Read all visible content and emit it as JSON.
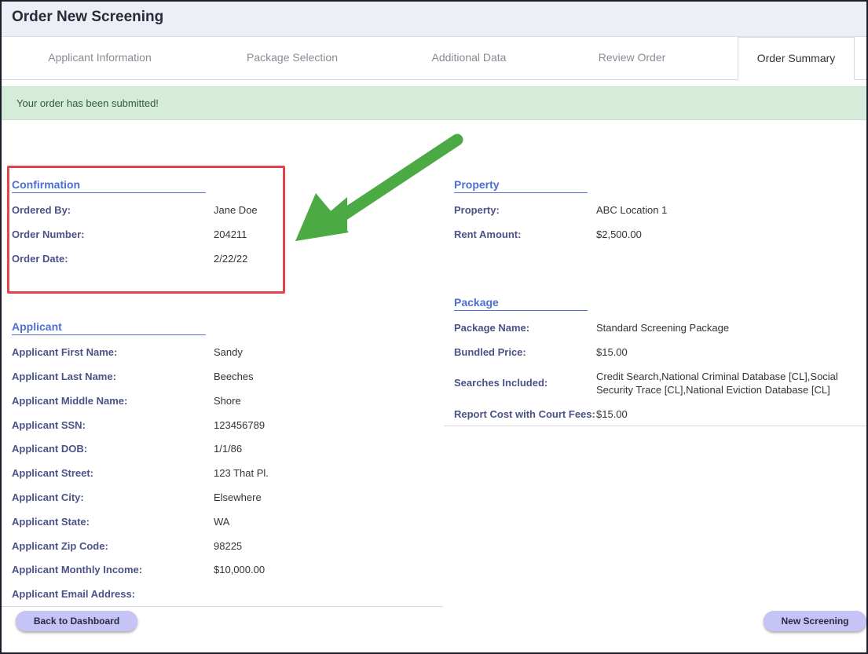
{
  "header": {
    "title": "Order New Screening"
  },
  "tabs": [
    {
      "label": "Applicant Information"
    },
    {
      "label": "Package Selection"
    },
    {
      "label": "Additional Data"
    },
    {
      "label": "Review Order"
    },
    {
      "label": "Order Summary",
      "active": true
    }
  ],
  "alert": {
    "message": "Your order has been submitted!"
  },
  "confirmation": {
    "title": "Confirmation",
    "rows": [
      {
        "label": "Ordered By:",
        "value": "Jane Doe"
      },
      {
        "label": "Order Number:",
        "value": "204211"
      },
      {
        "label": "Order Date:",
        "value": "2/22/22"
      }
    ]
  },
  "property": {
    "title": "Property",
    "rows": [
      {
        "label": "Property:",
        "value": "ABC Location 1"
      },
      {
        "label": "Rent Amount:",
        "value": "$2,500.00"
      }
    ]
  },
  "package": {
    "title": "Package",
    "rows": [
      {
        "label": "Package Name:",
        "value": "Standard Screening Package"
      },
      {
        "label": "Bundled Price:",
        "value": "$15.00"
      },
      {
        "label": "Searches Included:",
        "value": "Credit Search,National Criminal Database [CL],Social Security Trace [CL],National Eviction Database [CL]"
      },
      {
        "label": "Report Cost with Court Fees:",
        "value": "$15.00"
      }
    ]
  },
  "applicant": {
    "title": "Applicant",
    "rows": [
      {
        "label": "Applicant First Name:",
        "value": "Sandy"
      },
      {
        "label": "Applicant Last Name:",
        "value": "Beeches"
      },
      {
        "label": "Applicant Middle Name:",
        "value": "Shore"
      },
      {
        "label": "Applicant SSN:",
        "value": "123456789"
      },
      {
        "label": "Applicant DOB:",
        "value": "1/1/86"
      },
      {
        "label": "Applicant Street:",
        "value": "123 That Pl."
      },
      {
        "label": "Applicant City:",
        "value": "Elsewhere"
      },
      {
        "label": "Applicant State:",
        "value": "WA"
      },
      {
        "label": "Applicant Zip Code:",
        "value": "98225"
      },
      {
        "label": "Applicant Monthly Income:",
        "value": "$10,000.00"
      },
      {
        "label": "Applicant Email Address:",
        "value": ""
      }
    ]
  },
  "buttons": {
    "back_label": "Back to Dashboard",
    "new_label": "New Screening"
  },
  "colors": {
    "accent": "#4d6fd1",
    "label": "#4b5287",
    "success_bg": "#d4ecd9",
    "highlight": "#e5434c",
    "arrow": "#4caa45",
    "button": "#c6c3f6"
  },
  "icons": {
    "annotation_arrow": "arrow-icon"
  }
}
